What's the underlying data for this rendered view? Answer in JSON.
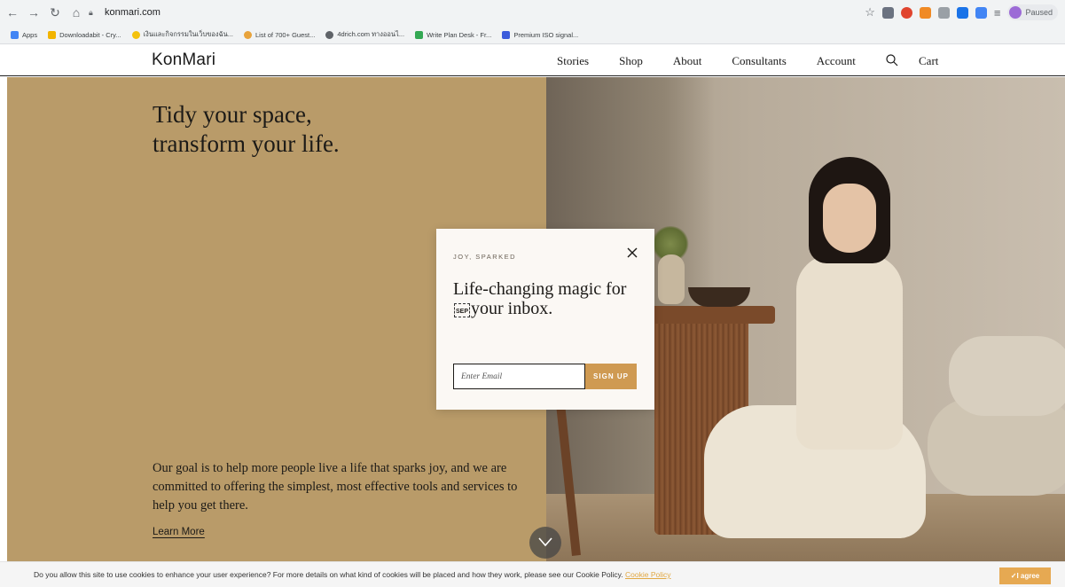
{
  "browser": {
    "url": "konmari.com",
    "profile_status": "Paused",
    "bookmarks": [
      {
        "label": "Apps",
        "color": "#4285f4"
      },
      {
        "label": "Downloadabit - Cry...",
        "color": "#f2b400"
      },
      {
        "label": "เงินและกิจกรรมในเว็บของฉัน...",
        "color": "#f4c20d"
      },
      {
        "label": "List of 700+ Guest...",
        "color": "#e8a33c"
      },
      {
        "label": "4drich.com ทางออนไ...",
        "color": "#5f6368"
      },
      {
        "label": "Write Plan Desk - Fr...",
        "color": "#34a853"
      },
      {
        "label": "Premium ISO signal...",
        "color": "#3b5bdb"
      }
    ]
  },
  "site": {
    "logo": "KonMari",
    "nav": [
      "Stories",
      "Shop",
      "About",
      "Consultants",
      "Account"
    ],
    "cart": "Cart"
  },
  "hero": {
    "headline_line1": "Tidy your space,",
    "headline_line2": "transform your life.",
    "mission": "Our goal is to help more people live a life that sparks joy, and we are committed to offering the simplest, most effective tools and services to help you get there.",
    "learn_more": "Learn More",
    "colors": {
      "panel": "#b99b69"
    }
  },
  "popup": {
    "eyebrow": "JOY, SPARKED",
    "title_part1": "Life-changing magic for",
    "sep_mark": "SEP",
    "title_part2": "your inbox.",
    "email_placeholder": "Enter Email",
    "signup_label": "SIGN UP",
    "colors": {
      "accent": "#cf9a52"
    }
  },
  "cookie_bar": {
    "text": "Do you allow this site to use cookies to enhance your user experience? For more details on what kind of cookies will be placed and how they work, please see our Cookie Policy.",
    "policy_link": "Cookie Policy",
    "agree_label": "✓I agree"
  }
}
